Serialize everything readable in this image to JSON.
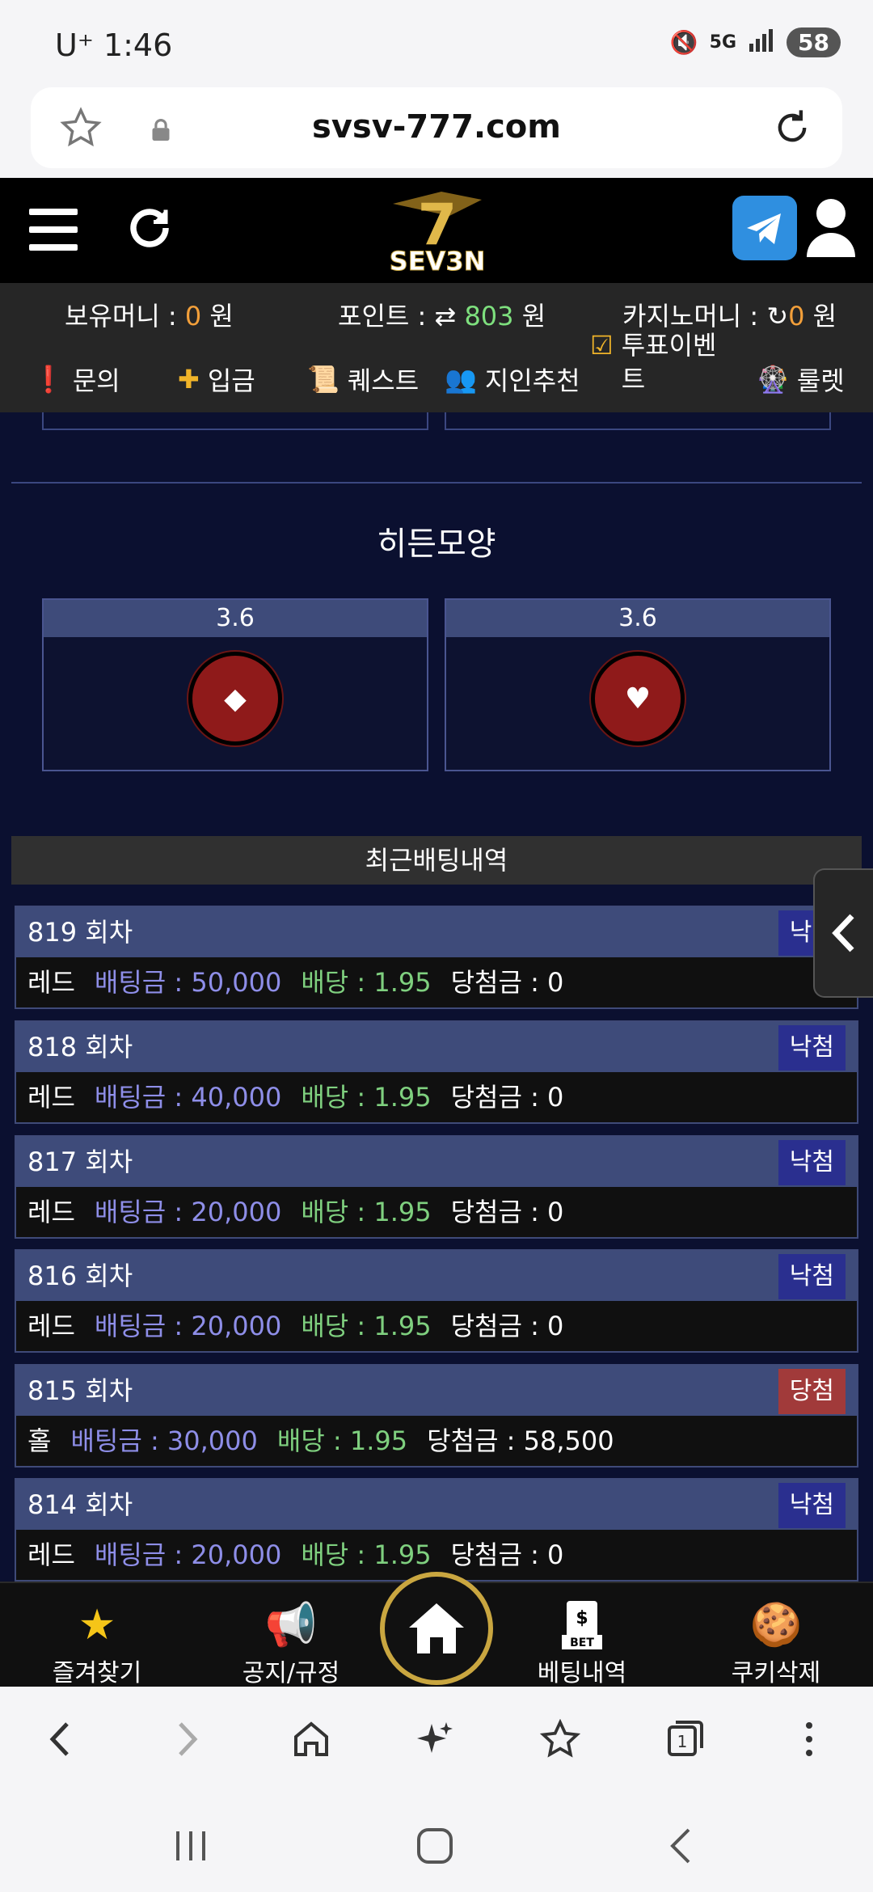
{
  "status": {
    "carrier": "U⁺ 1:46",
    "network": "5G",
    "battery": "58"
  },
  "browser": {
    "url": "svsv-777.com"
  },
  "logo": {
    "text": "SEV3N"
  },
  "info": {
    "holding_label": "보유머니 : ",
    "holding_value": "0",
    "holding_unit": " 원",
    "point_label": "포인트 : ",
    "point_value": "803",
    "point_unit": " 원",
    "casino_label": "카지노머니 : ",
    "casino_value": "0",
    "casino_unit": " 원"
  },
  "menu": {
    "inquiry": "문의",
    "deposit": "입금",
    "quest": "퀘스트",
    "referral": "지인추천",
    "vote_event": "투표이벤트",
    "roulette": "룰렛"
  },
  "hidden_shape": {
    "title": "히든모양",
    "options": [
      {
        "odds": "3.6",
        "symbol": "◆",
        "icon": "diamond-icon"
      },
      {
        "odds": "3.6",
        "symbol": "♥",
        "icon": "heart-icon"
      }
    ]
  },
  "history": {
    "title": "최근배팅내역",
    "amount_label": "배팅금 : ",
    "rate_label": "배당 : ",
    "win_label": "당첨금 : ",
    "rows": [
      {
        "round": "819 회차",
        "pick": "레드",
        "amount": "50,000",
        "rate": "1.95",
        "win": "0",
        "status": "낙첨",
        "won": false
      },
      {
        "round": "818 회차",
        "pick": "레드",
        "amount": "40,000",
        "rate": "1.95",
        "win": "0",
        "status": "낙첨",
        "won": false
      },
      {
        "round": "817 회차",
        "pick": "레드",
        "amount": "20,000",
        "rate": "1.95",
        "win": "0",
        "status": "낙첨",
        "won": false
      },
      {
        "round": "816 회차",
        "pick": "레드",
        "amount": "20,000",
        "rate": "1.95",
        "win": "0",
        "status": "낙첨",
        "won": false
      },
      {
        "round": "815 회차",
        "pick": "홀",
        "amount": "30,000",
        "rate": "1.95",
        "win": "58,500",
        "status": "당첨",
        "won": true
      },
      {
        "round": "814 회차",
        "pick": "레드",
        "amount": "20,000",
        "rate": "1.95",
        "win": "0",
        "status": "낙첨",
        "won": false
      }
    ]
  },
  "bottom_nav": {
    "favorites": "즐겨찾기",
    "notice": "공지/규정",
    "bet_history": "베팅내역",
    "clear_cookies": "쿠키삭제"
  },
  "colors": {
    "accent_orange": "#f29f3a",
    "green": "#7ee07e",
    "lose_badge": "#2a2f8f",
    "win_badge": "#a13a3a"
  }
}
